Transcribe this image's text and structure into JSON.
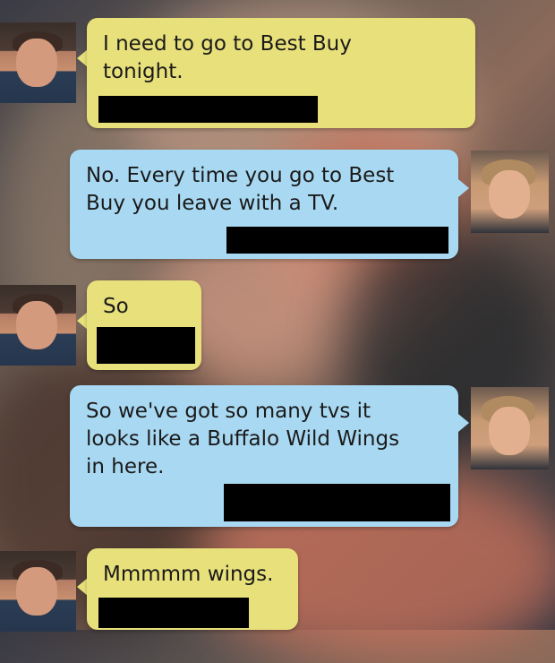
{
  "conversation": {
    "messages": [
      {
        "sender": "him",
        "text": "I need to go to Best Buy\ntonight."
      },
      {
        "sender": "her",
        "text": "No. Every time you go to Best\nBuy you leave with a TV."
      },
      {
        "sender": "him",
        "text": "So"
      },
      {
        "sender": "her",
        "text": "So we've got so many tvs it\nlooks like a Buffalo Wild Wings\nin here."
      },
      {
        "sender": "him",
        "text": "Mmmmm wings."
      }
    ]
  },
  "colors": {
    "him_bubble": "#e8e07a",
    "her_bubble": "#a9d9f2",
    "redaction": "#000000"
  }
}
